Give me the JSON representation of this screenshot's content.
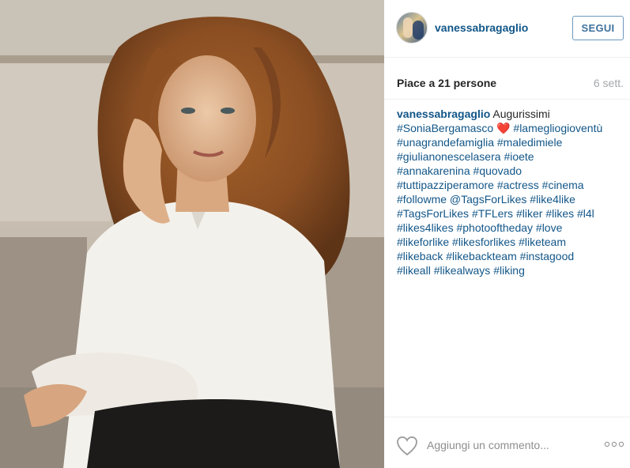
{
  "post": {
    "photo_icon": "portrait-photo",
    "user": {
      "username": "vanessabragaglio",
      "avatar_icon": "avatar-photo"
    },
    "follow_label": "SEGUI",
    "likes": {
      "prefix": "Piace a ",
      "count": "21",
      "suffix": " persone"
    },
    "time": "6 sett.",
    "caption": {
      "username": "vanessabragaglio",
      "first_line_text": " Augurissimi",
      "line2": {
        "tag": "#SoniaBergamasco",
        "emoji": " ❤️",
        "tag2": "#lamegliogioventù"
      },
      "lines": [
        [
          "#unagrandefamiglia",
          "#maledimiele"
        ],
        [
          "#giulianonescelasera",
          "#ioete"
        ],
        [
          "#annakarenina",
          "#quovado"
        ],
        [
          "#tuttipazziperamore",
          "#actress",
          "#cinema"
        ],
        [
          "#followme",
          "@TagsForLikes",
          "#like4like"
        ],
        [
          "#TagsForLikes",
          "#TFLers",
          "#liker",
          "#likes",
          "#l4l"
        ],
        [
          "#likes4likes",
          "#photooftheday",
          "#love"
        ],
        [
          "#likeforlike",
          "#likesforlikes",
          "#liketeam"
        ],
        [
          "#likeback",
          "#likebackteam",
          "#instagood"
        ],
        [
          "#likeall",
          "#likealways",
          "#liking"
        ]
      ]
    },
    "comment_placeholder": "Aggiungi un commento...",
    "icons": {
      "like": "heart-icon",
      "more": "more-options-icon"
    },
    "colors": {
      "link": "#125688",
      "button_border": "#6d98bf",
      "button_text": "#3f729b",
      "time": "#a5a7aa"
    }
  }
}
